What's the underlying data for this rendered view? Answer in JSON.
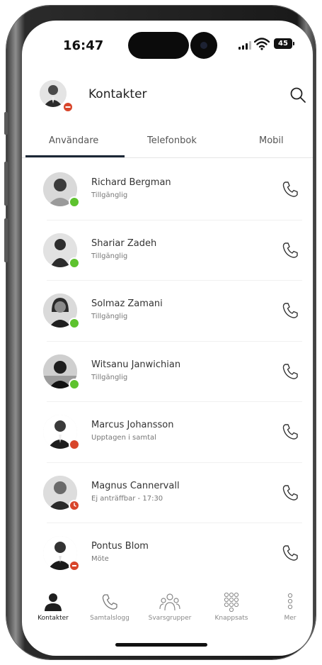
{
  "status_bar": {
    "time": "16:47",
    "battery": "45"
  },
  "header": {
    "title": "Kontakter"
  },
  "tabs": [
    {
      "label": "Användare",
      "active": true
    },
    {
      "label": "Telefonbok",
      "active": false
    },
    {
      "label": "Mobil",
      "active": false
    }
  ],
  "contacts": [
    {
      "name": "Richard Bergman",
      "status": "Tillgänglig",
      "presence": "available"
    },
    {
      "name": "Shariar Zadeh",
      "status": "Tillgänglig",
      "presence": "available"
    },
    {
      "name": "Solmaz Zamani",
      "status": "Tillgänglig",
      "presence": "available"
    },
    {
      "name": "Witsanu Janwichian",
      "status": "Tillgänglig",
      "presence": "available"
    },
    {
      "name": "Marcus Johansson",
      "status": "Upptagen i samtal",
      "presence": "busy"
    },
    {
      "name": "Magnus Cannervall",
      "status": "Ej anträffbar - 17:30",
      "presence": "away"
    },
    {
      "name": "Pontus Blom",
      "status": "Möte",
      "presence": "meeting"
    }
  ],
  "bottom_nav": [
    {
      "label": "Kontakter",
      "icon": "person-icon",
      "active": true
    },
    {
      "label": "Samtalslogg",
      "icon": "phone-icon",
      "active": false
    },
    {
      "label": "Svarsgrupper",
      "icon": "group-icon",
      "active": false
    },
    {
      "label": "Knappsats",
      "icon": "keypad-icon",
      "active": false
    },
    {
      "label": "Mer",
      "icon": "more-icon",
      "active": false
    }
  ],
  "colors": {
    "available": "#5dc22e",
    "busy": "#d8452a",
    "away": "#d8452a",
    "meeting": "#d8452a",
    "accent": "#1b2736"
  }
}
